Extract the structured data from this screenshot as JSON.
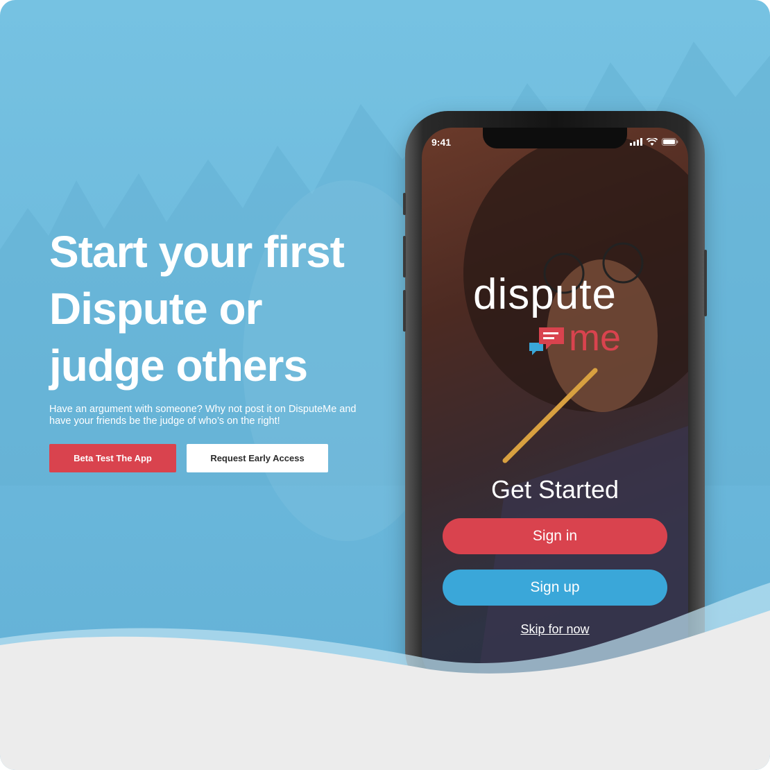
{
  "hero": {
    "headline": "Start your first\nDispute or\njudge others",
    "subtext": "Have an argument with someone? Why not post it on DisputeMe and have your friends be the judge of who’s on the right!"
  },
  "cta": {
    "primary_label": "Beta Test The App",
    "secondary_label": "Request Early Access"
  },
  "phone": {
    "status_time": "9:41",
    "logo_word": "dispute",
    "logo_me": "me",
    "get_started": "Get Started",
    "sign_in_label": "Sign in",
    "sign_up_label": "Sign up",
    "skip_label": "Skip for now"
  },
  "colors": {
    "background": "#6bb8db",
    "accent_red": "#d9434e",
    "accent_blue": "#3aa7d9",
    "wave": "#ececec"
  },
  "icons": [
    "signal-icon",
    "wifi-icon",
    "battery-icon",
    "chat-bubbles-icon"
  ]
}
